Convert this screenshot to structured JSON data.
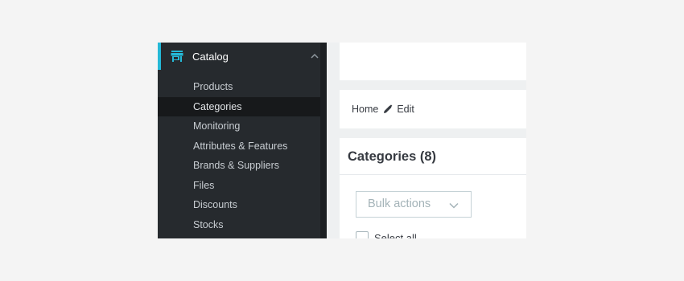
{
  "sidebar": {
    "section": {
      "title": "Catalog",
      "icon": "store-icon",
      "expand_icon": "chevron-up-icon"
    },
    "items": [
      {
        "label": "Products"
      },
      {
        "label": "Categories"
      },
      {
        "label": "Monitoring"
      },
      {
        "label": "Attributes & Features"
      },
      {
        "label": "Brands & Suppliers"
      },
      {
        "label": "Files"
      },
      {
        "label": "Discounts"
      },
      {
        "label": "Stocks"
      }
    ],
    "active_item": "Categories"
  },
  "breadcrumb": {
    "home": "Home",
    "edit_icon": "pencil-icon",
    "edit": "Edit"
  },
  "main": {
    "card_title": "Categories (8)",
    "bulk_actions": "Bulk actions",
    "select_all": "Select all"
  },
  "colors": {
    "accent": "#25b9d7",
    "sidebar_bg": "#262a2e",
    "active_bg": "#17191b"
  }
}
